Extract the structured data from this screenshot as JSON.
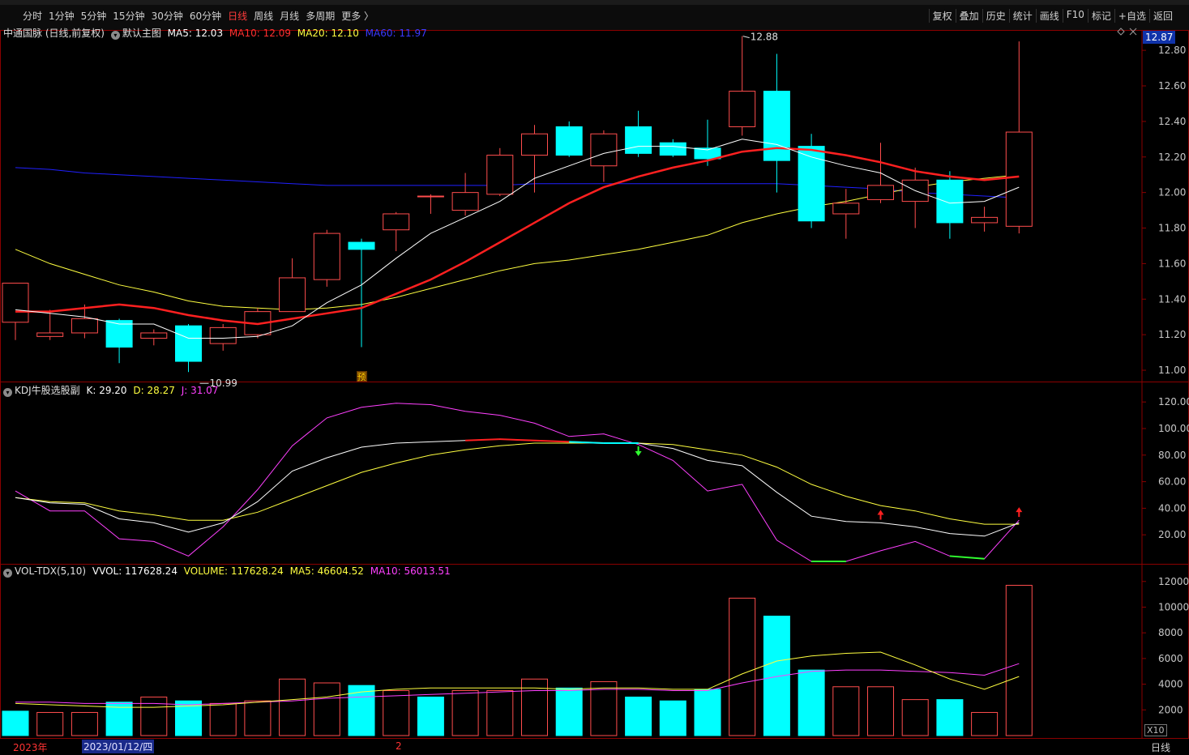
{
  "toolbar": {
    "periods": [
      "分时",
      "1分钟",
      "5分钟",
      "15分钟",
      "30分钟",
      "60分钟",
      "日线",
      "周线",
      "月线",
      "多周期",
      "更多 〉"
    ],
    "active_period": "日线",
    "tools": [
      "复权",
      "叠加",
      "历史",
      "统计",
      "画线",
      "F10",
      "标记",
      "+自选",
      "返回"
    ]
  },
  "main_panel": {
    "title": "中通国脉 (日线,前复权)",
    "template": "默认主图",
    "ma5": "MA5: 12.03",
    "ma10": "MA10: 12.09",
    "ma20": "MA20: 12.10",
    "ma60": "MA60: 11.97",
    "last_price": "12.87",
    "high_label": "12.88",
    "low_label": "10.99",
    "marker": "预"
  },
  "kdj_panel": {
    "title": "KDJ牛股选股副",
    "k": "K: 29.20",
    "d": "D: 28.27",
    "j": "J: 31.07"
  },
  "vol_panel": {
    "title": "VOL-TDX(5,10)",
    "vvol": "VVOL: 117628.24",
    "volume": "VOLUME: 117628.24",
    "ma5": "MA5: 46604.52",
    "ma10": "MA10: 56013.51",
    "unit": "X10"
  },
  "footer": {
    "year": "2023年",
    "cursor_date": "2023/01/12/四",
    "month": "2",
    "period": "日线"
  },
  "colors": {
    "up": "#ff4d4d",
    "down": "#00ffff",
    "ma5": "#ffffff",
    "ma10": "#ff2020",
    "ma20": "#ffff40",
    "ma60": "#2020ff",
    "j": "#ff40ff",
    "grid": "#8b0000"
  },
  "chart_data": [
    {
      "type": "candlestick",
      "title": "中通国脉 (日线,前复权)",
      "y_ticks": [
        11.0,
        11.2,
        11.4,
        11.6,
        11.8,
        12.0,
        12.2,
        12.4,
        12.6,
        12.8
      ],
      "ylim": [
        10.95,
        12.91
      ],
      "candles": [
        {
          "o": 11.27,
          "h": 11.49,
          "l": 11.17,
          "c": 11.49
        },
        {
          "o": 11.19,
          "h": 11.34,
          "l": 11.17,
          "c": 11.21
        },
        {
          "o": 11.21,
          "h": 11.37,
          "l": 11.18,
          "c": 11.29
        },
        {
          "o": 11.28,
          "h": 11.29,
          "l": 11.04,
          "c": 11.13
        },
        {
          "o": 11.18,
          "h": 11.23,
          "l": 11.14,
          "c": 11.21
        },
        {
          "o": 11.25,
          "h": 11.26,
          "l": 10.99,
          "c": 11.05
        },
        {
          "o": 11.15,
          "h": 11.26,
          "l": 11.11,
          "c": 11.24
        },
        {
          "o": 11.2,
          "h": 11.35,
          "l": 11.18,
          "c": 11.33
        },
        {
          "o": 11.33,
          "h": 11.63,
          "l": 11.33,
          "c": 11.52
        },
        {
          "o": 11.51,
          "h": 11.79,
          "l": 11.47,
          "c": 11.77
        },
        {
          "o": 11.72,
          "h": 11.74,
          "l": 11.13,
          "c": 11.68
        },
        {
          "o": 11.79,
          "h": 11.89,
          "l": 11.67,
          "c": 11.88
        },
        {
          "o": 11.98,
          "h": 11.99,
          "l": 11.88,
          "c": 11.98
        },
        {
          "o": 11.9,
          "h": 12.11,
          "l": 11.87,
          "c": 12.0
        },
        {
          "o": 11.99,
          "h": 12.25,
          "l": 11.98,
          "c": 12.21
        },
        {
          "o": 12.21,
          "h": 12.38,
          "l": 12.0,
          "c": 12.33
        },
        {
          "o": 12.37,
          "h": 12.4,
          "l": 12.2,
          "c": 12.21
        },
        {
          "o": 12.15,
          "h": 12.35,
          "l": 12.06,
          "c": 12.33
        },
        {
          "o": 12.37,
          "h": 12.46,
          "l": 12.2,
          "c": 12.22
        },
        {
          "o": 12.28,
          "h": 12.3,
          "l": 12.2,
          "c": 12.21
        },
        {
          "o": 12.25,
          "h": 12.41,
          "l": 12.15,
          "c": 12.19
        },
        {
          "o": 12.37,
          "h": 12.88,
          "l": 12.32,
          "c": 12.57
        },
        {
          "o": 12.57,
          "h": 12.78,
          "l": 12.0,
          "c": 12.18
        },
        {
          "o": 12.26,
          "h": 12.33,
          "l": 11.8,
          "c": 11.84
        },
        {
          "o": 11.88,
          "h": 12.02,
          "l": 11.74,
          "c": 11.94
        },
        {
          "o": 11.96,
          "h": 12.28,
          "l": 11.94,
          "c": 12.04
        },
        {
          "o": 11.95,
          "h": 12.14,
          "l": 11.8,
          "c": 12.07
        },
        {
          "o": 12.07,
          "h": 12.12,
          "l": 11.74,
          "c": 11.83
        },
        {
          "o": 11.83,
          "h": 11.92,
          "l": 11.78,
          "c": 11.86
        },
        {
          "o": 11.81,
          "h": 12.85,
          "l": 11.77,
          "c": 12.34
        }
      ],
      "ma5": [
        11.34,
        11.32,
        11.3,
        11.26,
        11.26,
        11.18,
        11.18,
        11.19,
        11.25,
        11.38,
        11.48,
        11.63,
        11.77,
        11.86,
        11.95,
        12.08,
        12.15,
        12.22,
        12.26,
        12.26,
        12.24,
        12.3,
        12.27,
        12.2,
        12.15,
        12.11,
        12.01,
        11.94,
        11.95,
        12.03
      ],
      "ma10": [
        11.33,
        11.33,
        11.35,
        11.37,
        11.35,
        11.31,
        11.28,
        11.26,
        11.29,
        11.32,
        11.35,
        11.43,
        11.51,
        11.61,
        11.72,
        11.83,
        11.94,
        12.03,
        12.09,
        12.14,
        12.18,
        12.23,
        12.25,
        12.24,
        12.21,
        12.17,
        12.12,
        12.09,
        12.07,
        12.09
      ],
      "ma20": [
        11.68,
        11.6,
        11.54,
        11.48,
        11.44,
        11.39,
        11.36,
        11.35,
        11.34,
        11.35,
        11.37,
        11.41,
        11.46,
        11.51,
        11.56,
        11.6,
        11.62,
        11.65,
        11.68,
        11.72,
        11.76,
        11.83,
        11.88,
        11.92,
        11.95,
        11.99,
        12.03,
        12.06,
        12.08,
        12.1
      ],
      "ma60": [
        12.14,
        12.13,
        12.11,
        12.1,
        12.09,
        12.08,
        12.07,
        12.06,
        12.05,
        12.04,
        12.04,
        12.04,
        12.04,
        12.04,
        12.04,
        12.05,
        12.05,
        12.05,
        12.05,
        12.05,
        12.05,
        12.05,
        12.05,
        12.04,
        12.03,
        12.02,
        12.0,
        11.99,
        11.98,
        11.97
      ]
    },
    {
      "type": "line",
      "title": "KDJ牛股选股副",
      "y_ticks": [
        20,
        40,
        60,
        80,
        100,
        120
      ],
      "ylim": [
        0,
        125
      ],
      "k": [
        48,
        44,
        43,
        32,
        29,
        22,
        29,
        45,
        68,
        78,
        86,
        89,
        90,
        91,
        92,
        91,
        90,
        89,
        89,
        85,
        76,
        72,
        52,
        34,
        30,
        29,
        26,
        21,
        19,
        29
      ],
      "d": [
        48,
        45,
        44,
        38,
        35,
        31,
        31,
        37,
        47,
        57,
        67,
        74,
        80,
        84,
        87,
        89,
        89,
        89,
        89,
        88,
        84,
        80,
        71,
        58,
        49,
        42,
        38,
        32,
        28,
        28
      ],
      "j": [
        53,
        38,
        38,
        17,
        15,
        4,
        26,
        54,
        87,
        108,
        116,
        119,
        118,
        113,
        110,
        104,
        94,
        96,
        88,
        76,
        53,
        58,
        16,
        0,
        0,
        8,
        15,
        4,
        2,
        31
      ],
      "arrows": [
        {
          "i": 18,
          "dir": "down"
        },
        {
          "i": 25,
          "dir": "up"
        },
        {
          "i": 29,
          "dir": "up"
        }
      ]
    },
    {
      "type": "bar",
      "title": "VOL-TDX(5,10)",
      "y_ticks": [
        2000,
        4000,
        6000,
        8000,
        10000,
        12000
      ],
      "ylim": [
        0,
        12300
      ],
      "volume": [
        1900,
        1800,
        1800,
        2600,
        3000,
        2700,
        2500,
        2700,
        4400,
        4100,
        3900,
        3500,
        3000,
        3500,
        3500,
        4400,
        3700,
        4200,
        3000,
        2700,
        3600,
        10700,
        9300,
        5100,
        3800,
        3800,
        2800,
        2800,
        1800,
        11700
      ],
      "up": [
        false,
        true,
        true,
        false,
        true,
        false,
        true,
        true,
        true,
        true,
        false,
        true,
        false,
        true,
        true,
        true,
        false,
        true,
        false,
        false,
        false,
        true,
        false,
        false,
        true,
        true,
        true,
        false,
        true,
        true
      ],
      "ma5": [
        2500,
        2400,
        2300,
        2200,
        2200,
        2300,
        2400,
        2600,
        2800,
        3000,
        3400,
        3600,
        3700,
        3700,
        3700,
        3700,
        3600,
        3700,
        3700,
        3600,
        3600,
        4800,
        5800,
        6200,
        6400,
        6500,
        5500,
        4400,
        3600,
        4600
      ],
      "ma10": [
        2600,
        2600,
        2500,
        2500,
        2500,
        2400,
        2500,
        2600,
        2700,
        2900,
        3000,
        3100,
        3200,
        3300,
        3400,
        3500,
        3500,
        3600,
        3600,
        3500,
        3500,
        4100,
        4600,
        5000,
        5100,
        5100,
        5000,
        4900,
        4700,
        5600
      ]
    }
  ]
}
